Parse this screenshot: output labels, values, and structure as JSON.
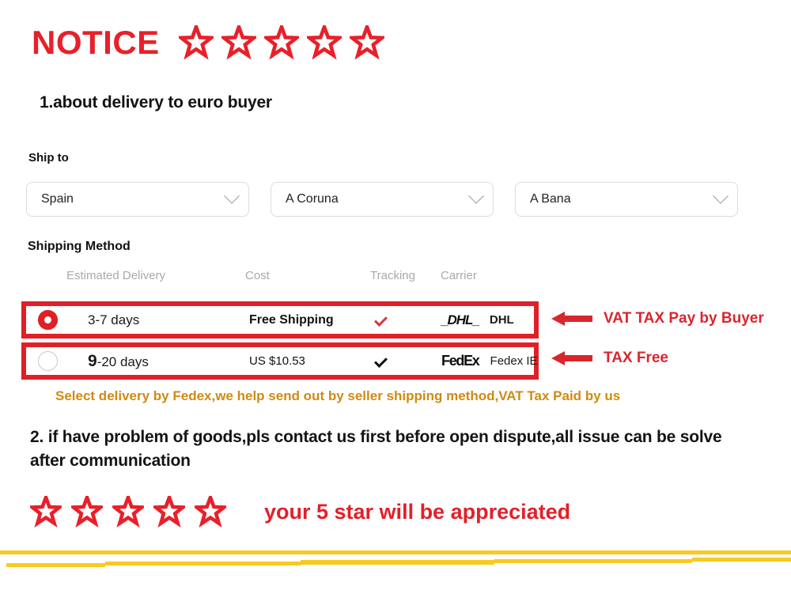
{
  "header": {
    "title": "NOTICE",
    "star_count": 5,
    "star_color": "#e8202a"
  },
  "section1": {
    "heading": "1.about delivery to euro buyer"
  },
  "ship_to": {
    "label": "Ship to",
    "selects": [
      {
        "name": "country",
        "value": "Spain",
        "icon": "chevron-down-icon"
      },
      {
        "name": "province",
        "value": "A Coruna",
        "icon": "chevron-down-icon"
      },
      {
        "name": "city",
        "value": "A Bana",
        "icon": "chevron-down-icon"
      }
    ]
  },
  "shipping_method": {
    "label": "Shipping Method",
    "columns": [
      "Estimated Delivery",
      "Cost",
      "Tracking",
      "Carrier"
    ],
    "options": [
      {
        "selected": true,
        "delivery_lead": "3",
        "delivery_rest": "-7 days",
        "cost": "Free Shipping",
        "cost_bold": true,
        "tracking": "check-icon",
        "tracking_color": "#d6383f",
        "carrier_logo": "DHL",
        "carrier_name": "DHL",
        "carrier_name_bold": true,
        "annotation": "VAT TAX Pay by Buyer"
      },
      {
        "selected": false,
        "delivery_lead": "9",
        "delivery_rest": "-20 days",
        "cost": "US $10.53",
        "cost_bold": false,
        "tracking": "check-icon",
        "tracking_color": "#111111",
        "carrier_logo": "FedEx",
        "carrier_name": "Fedex IE",
        "carrier_name_bold": false,
        "annotation": "TAX Free"
      }
    ],
    "highlight_color": "#e02027",
    "note": "Select delivery by Fedex,we help send out by seller shipping method,VAT Tax Paid by us",
    "note_color": "#cf8a13"
  },
  "section2": {
    "text": "2. if have problem of goods,pls contact us first before open dispute,all issue can be solve after communication"
  },
  "footer": {
    "star_count": 5,
    "message": "your 5 star will be appreciated",
    "message_color": "#e2202a",
    "bar_color": "#f8c921"
  }
}
